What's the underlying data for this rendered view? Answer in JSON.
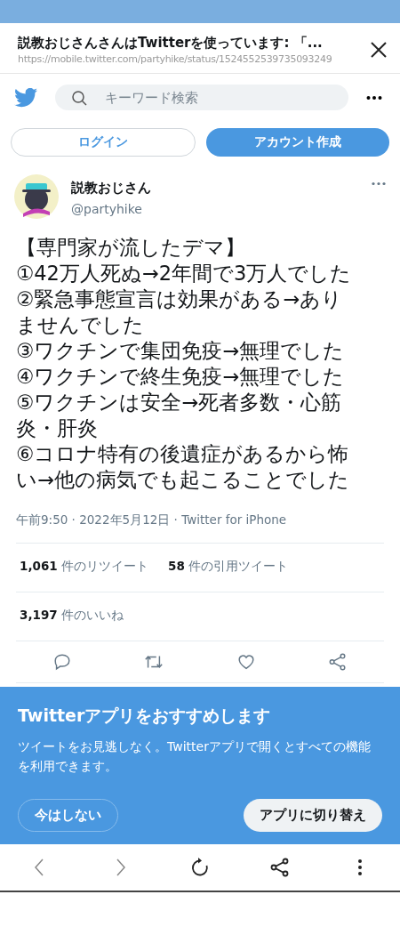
{
  "browser_header": {
    "title": "説教おじさんさんはTwitterを使っています: 「...",
    "url": "https://mobile.twitter.com/partyhike/status/1524552539735093249"
  },
  "top_bar": {
    "search": {
      "placeholder": "キーワード検索"
    }
  },
  "auth_buttons": [
    {
      "label": "ログイン",
      "kind": "outline"
    },
    {
      "label": "アカウント作成",
      "kind": "filled"
    }
  ],
  "tweet": {
    "author": {
      "name": "説教おじさん",
      "handle": "@partyhike"
    },
    "text": "【専門家が流したデマ】\n①42万人死ぬ→2年間で3万人でした\n②緊急事態宣言は効果がある→ありませんでした\n③ワクチンで集団免疫→無理でした\n④ワクチンで終生免疫→無理でした\n⑤ワクチンは安全→死者多数・心筋炎・肝炎\n⑥コロナ特有の後遺症があるから怖い→他の病気でも起こることでした",
    "meta": "午前9:50 · 2022年5月12日 · Twitter for iPhone",
    "stats": [
      {
        "count": "1,061",
        "label": "件のリツイート"
      },
      {
        "count": "58",
        "label": "件の引用ツイート"
      }
    ],
    "likes": {
      "count": "3,197",
      "label": "件のいいね"
    }
  },
  "app_banner": {
    "title": "Twitterアプリをおすすめします",
    "body": "ツイートをお見逃しなく。Twitterアプリで開くとすべての機能を利用できます。",
    "buttons": [
      {
        "label": "今はしない",
        "kind": "outline"
      },
      {
        "label": "アプリに切り替え",
        "kind": "filled"
      }
    ]
  }
}
